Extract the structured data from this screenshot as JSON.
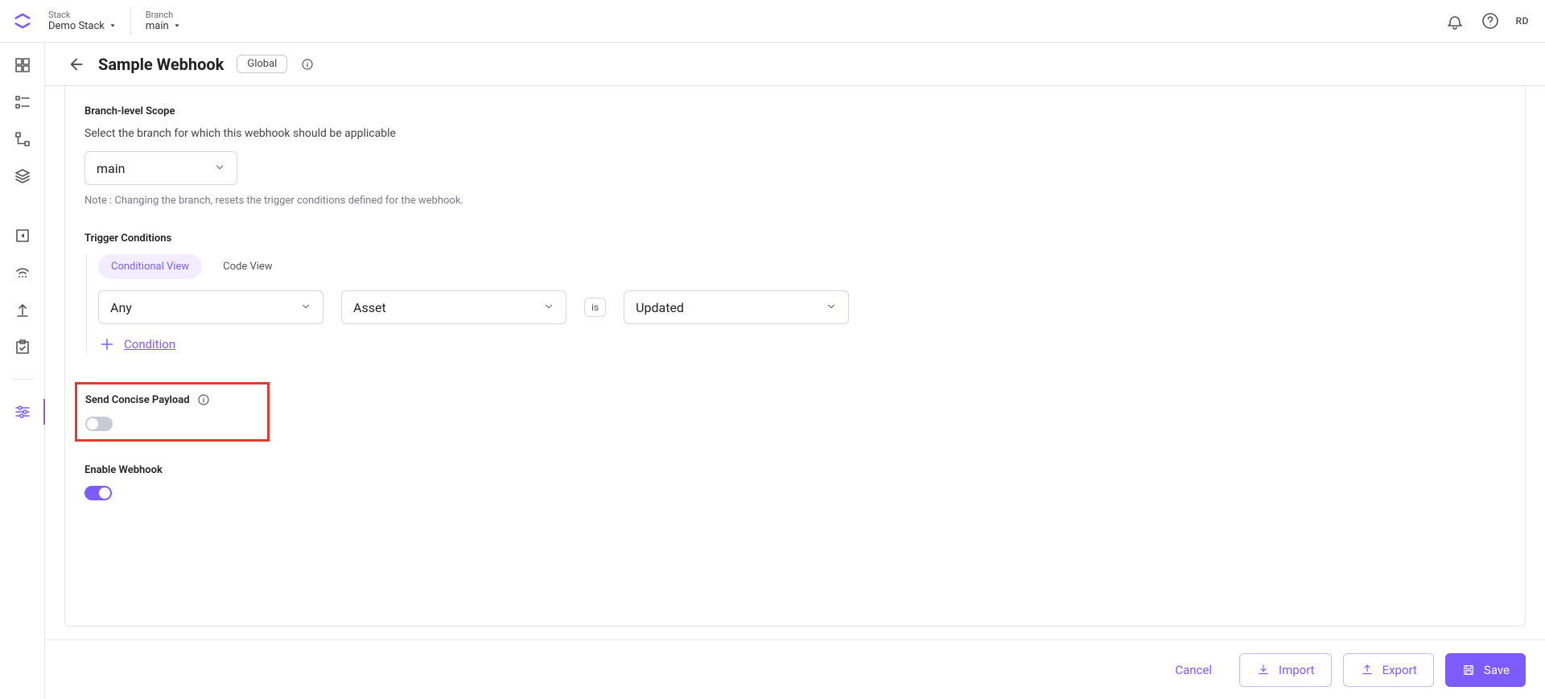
{
  "header": {
    "stack_label": "Stack",
    "stack_value": "Demo Stack",
    "branch_label": "Branch",
    "branch_value": "main",
    "user_initials": "RD"
  },
  "page": {
    "title": "Sample Webhook",
    "scope_badge": "Global"
  },
  "branch_scope": {
    "label": "Branch-level Scope",
    "description": "Select the branch for which this webhook should be applicable",
    "selected": "main",
    "note": "Note : Changing the branch, resets the trigger conditions defined for the webhook."
  },
  "triggers": {
    "label": "Trigger Conditions",
    "tabs": {
      "conditional": "Conditional View",
      "code": "Code View"
    },
    "row": {
      "quantifier": "Any",
      "resource": "Asset",
      "operator": "is",
      "event": "Updated"
    },
    "add_label": "Condition"
  },
  "concise": {
    "label": "Send Concise Payload",
    "enabled": false
  },
  "enable": {
    "label": "Enable Webhook",
    "enabled": true
  },
  "footer": {
    "cancel": "Cancel",
    "import": "Import",
    "export": "Export",
    "save": "Save"
  }
}
